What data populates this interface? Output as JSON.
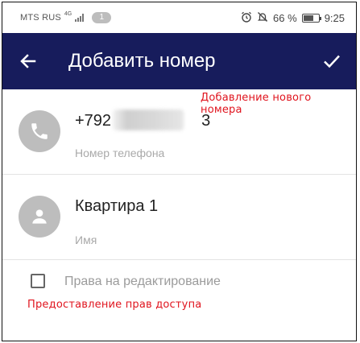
{
  "status_bar": {
    "carrier": "MTS RUS",
    "network": "4G",
    "notification_count": "1",
    "battery_percent": "66 %",
    "time": "9:25",
    "battery_level": 0.66,
    "icons": [
      "signal-icon",
      "alarm-icon",
      "bell-off-icon",
      "battery-icon"
    ]
  },
  "app_bar": {
    "title": "Добавить номер",
    "back_icon": "arrow-left-icon",
    "confirm_icon": "check-icon",
    "background": "#171c5c"
  },
  "annotations": {
    "add_new_number": "Добавление нового номера",
    "grant_access": "Предоставление прав доступа",
    "color": "#e0141e"
  },
  "phone_field": {
    "value_visible_prefix": "+792",
    "value_visible_suffix": "3",
    "hint": "Номер телефона",
    "icon": "phone-icon"
  },
  "name_field": {
    "value": "Квартира 1",
    "hint": "Имя",
    "icon": "person-icon"
  },
  "edit_rights": {
    "label": "Права на редактирование",
    "checked": false
  }
}
